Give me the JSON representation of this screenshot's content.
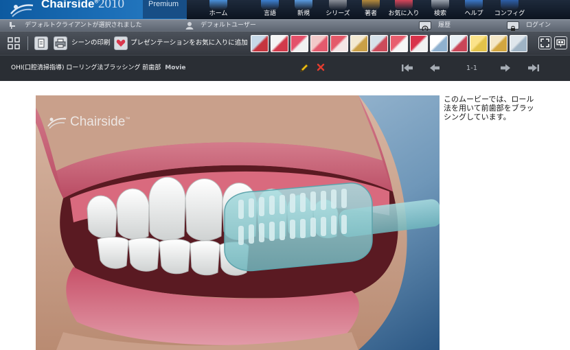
{
  "app": {
    "name": "Chairside",
    "trademark": "®",
    "year": "2010",
    "edition": "Premium"
  },
  "nav": [
    {
      "id": "home",
      "label": "ホーム",
      "icon": "home-icon",
      "color": "#4a90d9"
    },
    {
      "id": "dictionary",
      "label": "言語",
      "icon": "dictionary-icon",
      "color": "#3c7fd0"
    },
    {
      "id": "new",
      "label": "新規",
      "icon": "new-icon",
      "color": "#5a9be0"
    },
    {
      "id": "series",
      "label": "シリーズ",
      "icon": "series-icon",
      "color": "#8a8f98"
    },
    {
      "id": "author",
      "label": "著者",
      "icon": "author-icon",
      "color": "#b48a3c"
    },
    {
      "id": "favorites",
      "label": "お気に入り",
      "icon": "favorites-icon",
      "color": "#d6455a"
    },
    {
      "id": "search",
      "label": "検索",
      "icon": "search-icon",
      "color": "#9aa2ad"
    },
    {
      "id": "help",
      "label": "ヘルプ",
      "icon": "help-icon",
      "color": "#3a78c8"
    },
    {
      "id": "config",
      "label": "コンフィグ",
      "icon": "config-icon",
      "color": "#2d5fa8"
    }
  ],
  "status": {
    "client": "デフォルトクライアントが選択されました",
    "user": "デフォルトユーザー",
    "history": "履歴",
    "login": "ログイン"
  },
  "toolbar": {
    "print_scene": "シーンの印刷",
    "add_favorite": "プレゼンテーションをお気に入りに追加"
  },
  "thumbnails": [
    {
      "name": "thumbnail-1",
      "colors": [
        "#c7d9e8",
        "#c4353f"
      ]
    },
    {
      "name": "thumbnail-2",
      "colors": [
        "#f4f4f4",
        "#d13a4b"
      ]
    },
    {
      "name": "thumbnail-3",
      "colors": [
        "#e4526b",
        "#f1f1f1"
      ]
    },
    {
      "name": "thumbnail-4",
      "colors": [
        "#f2c9c9",
        "#e35a6d"
      ]
    },
    {
      "name": "thumbnail-5",
      "colors": [
        "#e45a6a",
        "#f4e6e6"
      ]
    },
    {
      "name": "thumbnail-6",
      "colors": [
        "#f3e9d2",
        "#caa047"
      ]
    },
    {
      "name": "thumbnail-7",
      "colors": [
        "#d7e2ea",
        "#cc4b5a"
      ]
    },
    {
      "name": "thumbnail-8",
      "colors": [
        "#e85e6e",
        "#f6f6f6"
      ]
    },
    {
      "name": "thumbnail-9",
      "colors": [
        "#d9344b",
        "#f1f1f1"
      ]
    },
    {
      "name": "thumbnail-10",
      "colors": [
        "#ffffff",
        "#8fb1cf"
      ]
    },
    {
      "name": "thumbnail-11",
      "colors": [
        "#e9f0f5",
        "#c94557"
      ]
    },
    {
      "name": "thumbnail-12",
      "colors": [
        "#fbe38a",
        "#e2c24a"
      ]
    },
    {
      "name": "thumbnail-13",
      "colors": [
        "#f4e7c7",
        "#d2a640"
      ]
    },
    {
      "name": "thumbnail-14",
      "colors": [
        "#dfe6ec",
        "#9fb3c4"
      ]
    }
  ],
  "presentation": {
    "title": "OHI(口腔清掃指導) ローリング法ブラッシング 前歯部",
    "type": "Movie",
    "page": "1-1",
    "description": "このムービーでは、ロール法を用いて前歯部をブラッシングしています。",
    "watermark": "Chairside",
    "watermark_tm": "™"
  },
  "colors": {
    "accent": "#1c6fb8",
    "edit": "#f2c31a",
    "delete": "#e43c2f"
  }
}
